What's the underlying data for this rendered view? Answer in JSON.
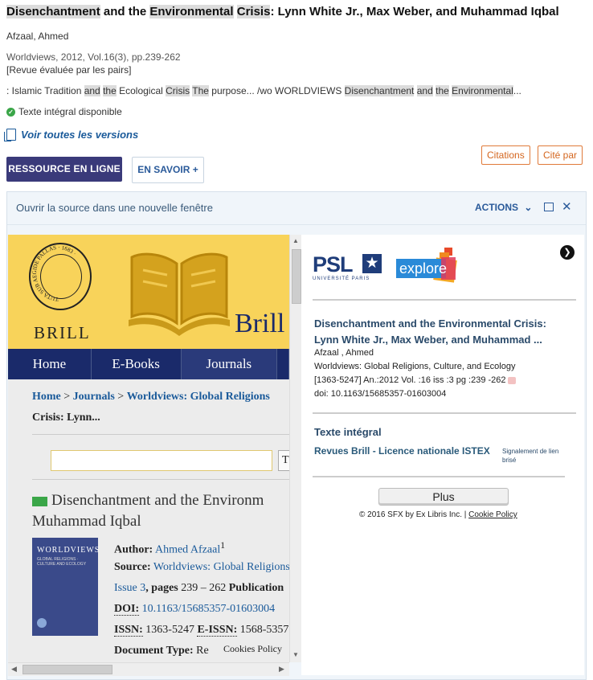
{
  "record": {
    "title_parts": [
      "Disenchantment",
      " and the ",
      "Environmental",
      " ",
      "Crisis",
      ": Lynn White Jr., Max Weber, and Muhammad Iqbal"
    ],
    "author": "Afzaal, Ahmed",
    "source": "Worldviews, 2012, Vol.16(3), pp.239-262",
    "peer_review": "[Revue évaluée par les pairs]",
    "snippet_parts": [
      ": Islamic Tradition ",
      "and",
      " ",
      "the",
      " Ecological ",
      "Crisis",
      " ",
      "The",
      " purpose... /wo WORLDVIEWS ",
      "Disenchantment",
      " ",
      "and",
      " ",
      "the",
      " ",
      "Environmental",
      "..."
    ],
    "availability": "Texte intégral disponible",
    "versions": "Voir toutes les versions",
    "btn_citations": "Citations",
    "btn_cite_par": "Cité par",
    "btn_ressource": "RESSOURCE EN LIGNE",
    "btn_savoir": "EN SAVOIR +"
  },
  "panel": {
    "open_source": "Ouvrir la source dans une nouvelle fenêtre",
    "actions": "ACTIONS",
    "chevron": "⌄",
    "close": "✕"
  },
  "brill": {
    "seal_text": "TUTA SUB AEGIDE PALLAS · 1683 ·",
    "wordmark": "BRILL",
    "big_wordmark": "Brill",
    "nav": [
      "Home",
      "E-Books",
      "Journals",
      ""
    ],
    "breadcrumb": [
      "Home",
      " > ",
      "Journals",
      " > ",
      "Worldviews: Global Religions"
    ],
    "breadcrumb2": "Crisis: Lynn...",
    "search_btn": "T",
    "article_title_1": "Disenchantment and the Environm",
    "article_title_2": "Muhammad Iqbal",
    "cover_title": "WORLDVIEWS",
    "cover_sub": "GLOBAL RELIGIONS · CULTURE AND ECOLOGY",
    "author_label": "Author:",
    "author_value": "Ahmed Afzaal",
    "author_sup": "1",
    "source_label": "Source:",
    "source_value": "Worldviews: Global Religions",
    "issue_value": "Issue 3",
    "pages_label": ", pages",
    "pages_value": " 239 – 262 ",
    "publication_label": "Publication",
    "doi_label": "DOI:",
    "doi_value": "10.1163/15685357-01603004",
    "issn_label": "ISSN:",
    "issn_value": " 1363-5247 ",
    "eissn_label": "E-ISSN:",
    "eissn_value": " 1568-5357",
    "doctype_label": "Document Type:",
    "doctype_value": " Re",
    "cookies": "Cookies Policy"
  },
  "sfx": {
    "psl": "PSL",
    "psl_sub": "UNIVERSITÉ PARIS",
    "star": "★",
    "explore": "explore",
    "title": "Disenchantment and the Environmental Crisis: Lynn White Jr., Max Weber, and Muhammad ...",
    "author": "Afzaal , Ahmed",
    "journal": "Worldviews: Global Religions, Culture, and Ecology",
    "details": "[1363-5247] An.:2012 Vol. :16 iss :3 pg :239 -262",
    "doi": "doi: 10.1163/15685357-01603004",
    "texte_integral": "Texte intégral",
    "link": "Revues Brill - Licence nationale ISTEX",
    "signalement": "Signalement de lien brisé",
    "plus": "Plus",
    "copyright": "© 2016 SFX by Ex Libris Inc. | ",
    "cookie_policy": "Cookie Policy"
  },
  "colors": {
    "brand_dark": "#3a3a7a",
    "brill_yellow": "#f8d35a",
    "brill_navy": "#1a2a6a",
    "citation_orange": "#d4661e",
    "link_blue": "#1a5a9a"
  }
}
